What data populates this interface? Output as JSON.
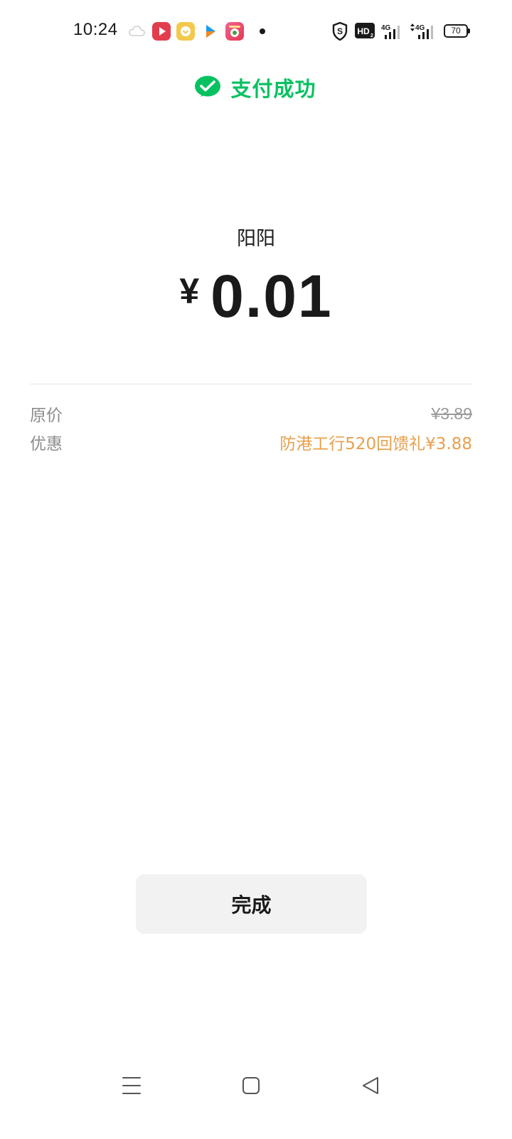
{
  "status_bar": {
    "time": "10:24",
    "network_1": "4G",
    "network_2": "4G",
    "hd_label": "HD",
    "battery": "70"
  },
  "header": {
    "title": "支付成功",
    "brand_color": "#07c160"
  },
  "payment": {
    "payee": "阳阳",
    "currency_symbol": "¥",
    "amount": "0.01"
  },
  "details": {
    "original_price_label": "原价",
    "original_price_value": "¥3.89",
    "discount_label": "优惠",
    "discount_value": "防港工行520回馈礼¥3.88",
    "discount_color": "#e8a04c"
  },
  "actions": {
    "done_label": "完成"
  },
  "nav_bar": {
    "items": [
      "menu-icon",
      "home-icon",
      "back-icon"
    ]
  }
}
